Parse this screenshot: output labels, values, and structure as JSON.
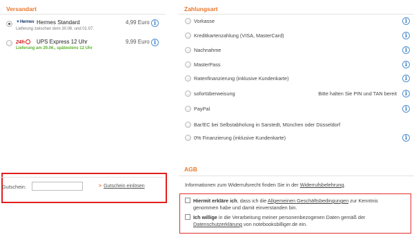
{
  "shipping": {
    "title": "Versandart",
    "options": [
      {
        "carrier": "Hermes",
        "name": "Hermes Standard",
        "sub": "Lieferung zwischen dem 30.06. und 01.07.",
        "price": "4,99 Euro",
        "selected": true
      },
      {
        "carrier": "24h",
        "name": "UPS Express 12 Uhr",
        "sub": "Lieferung am 29.06., spätestens 12 Uhr",
        "price": "9,99 Euro",
        "selected": false
      }
    ]
  },
  "payment": {
    "title": "Zahlungsart",
    "options": [
      {
        "label": "Vorkasse",
        "info": true
      },
      {
        "label": "Kreditkartenzahlung (VISA, MasterCard)",
        "info": true
      },
      {
        "label": "Nachnahme",
        "info": true
      },
      {
        "label": "MasterPass",
        "info": true
      },
      {
        "label": "Ratenfinanzierung (inklusive Kundenkarte)",
        "info": true
      },
      {
        "label": "sofortüberweisung",
        "note": "Bitte halten Sie PIN und TAN bereit",
        "info": true
      },
      {
        "label": "PayPal",
        "info": true
      },
      {
        "label": "Bar/EC bei Selbstabholung in Sarstedt, München oder Düsseldorf",
        "info": false
      },
      {
        "label": "0% Finanzierung (inklusive Kundenkarte)",
        "info": true
      }
    ]
  },
  "coupon": {
    "label": "Gutschein:",
    "value": "",
    "link": "Gutschein einlösen"
  },
  "agb": {
    "title": "AGB",
    "info_prefix": "Informationen zum Widerrufsrecht finden Sie in der ",
    "info_link": "Widerrufsbelehrung",
    "info_suffix": ".",
    "consent1_bold": "Hiermit erkläre ich",
    "consent1_a": ", dass ich die ",
    "consent1_link": "Allgemeinen Geschäftsbedingungen",
    "consent1_b": " zur Kenntnis genommen habe und damit einverstanden bin.",
    "consent2_bold": "Ich willige",
    "consent2_a": " in die Verarbeitung meiner personenbezogenen Daten gemäß der ",
    "consent2_link": "Datenschutzerklärung",
    "consent2_b": " von notebooksbilliger.de ein."
  },
  "icons": {
    "info": "i"
  },
  "colors": {
    "accent": "#e8762c",
    "highlight_box": "#e31b1b",
    "info": "#2f78c4",
    "success": "#5bb32c"
  }
}
